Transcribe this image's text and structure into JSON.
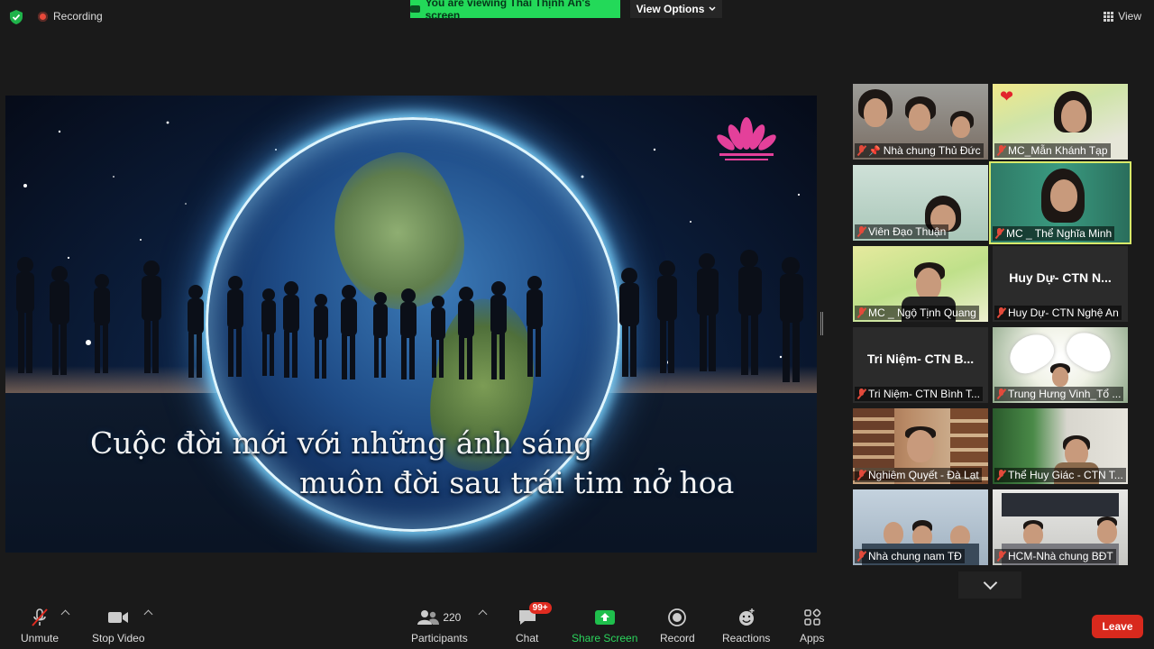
{
  "topbar": {
    "recording_label": "Recording",
    "viewing_label": "You are viewing Thái Thịnh Ấn's screen",
    "view_options_label": "View Options",
    "view_label": "View"
  },
  "shared_screen": {
    "lyric_line1": "Cuộc đời mới với những ánh sáng",
    "lyric_line2": "muôn đời sau trái tim nở hoa"
  },
  "participants": [
    {
      "name": "Nhà chung Thủ Đức",
      "pinned": true,
      "video": true
    },
    {
      "name": "MC_Mẫn Khánh Tạp",
      "video": true,
      "reaction": "heart"
    },
    {
      "name": "Viên Đạo Thuận",
      "video": true
    },
    {
      "name": "MC _ Thể Nghĩa Minh",
      "video": true,
      "active_speaker": true
    },
    {
      "name": "MC _ Ngộ Tịnh Quang",
      "video": true
    },
    {
      "name": "Huy Dự- CTN Nghệ An",
      "video": false,
      "display_name": "Huy Dự- CTN N..."
    },
    {
      "name": "Tri Niệm- CTN Bình T...",
      "video": false,
      "display_name": "Tri Niệm- CTN B..."
    },
    {
      "name": "Trung Hưng Vinh_Tổ ...",
      "video": true
    },
    {
      "name": "Nghiêm Quyết - Đà Lạt",
      "video": true
    },
    {
      "name": "Thể Huy Giác - CTN T...",
      "video": true
    },
    {
      "name": "Nhà chung nam TĐ",
      "video": true
    },
    {
      "name": "HCM-Nhà chung BĐT",
      "video": true
    }
  ],
  "toolbar": {
    "unmute_label": "Unmute",
    "stop_video_label": "Stop Video",
    "participants_label": "Participants",
    "participants_count": "220",
    "chat_label": "Chat",
    "chat_badge": "99+",
    "share_screen_label": "Share Screen",
    "record_label": "Record",
    "reactions_label": "Reactions",
    "apps_label": "Apps",
    "leave_label": "Leave"
  },
  "colors": {
    "share_banner": "#23d959",
    "leave": "#d8291d",
    "active_speaker_border": "#d8ea6a",
    "muted_icon": "#e24a3b"
  }
}
